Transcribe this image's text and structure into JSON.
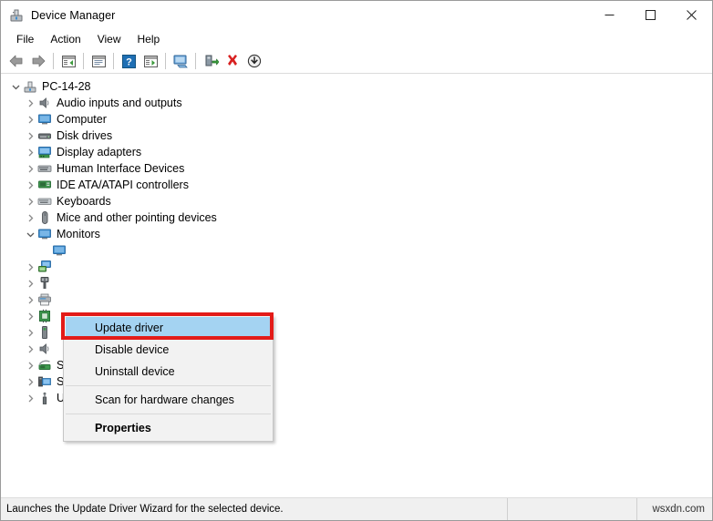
{
  "window": {
    "title": "Device Manager",
    "icon": "device-manager-icon",
    "controls": {
      "minimize": "–",
      "maximize": "□",
      "close": "✕"
    }
  },
  "menubar": {
    "items": [
      {
        "label": "File"
      },
      {
        "label": "Action"
      },
      {
        "label": "View"
      },
      {
        "label": "Help"
      }
    ]
  },
  "toolbar": {
    "buttons": [
      {
        "name": "back-icon",
        "title": "Back"
      },
      {
        "name": "forward-icon",
        "title": "Forward"
      },
      {
        "name": "show-hide-console-tree-icon",
        "title": "Show/Hide Console Tree"
      },
      {
        "name": "properties-icon",
        "title": "Properties"
      },
      {
        "name": "help-icon",
        "title": "Help"
      },
      {
        "name": "show-hide-action-pane-icon",
        "title": "Show/Hide Action Pane"
      },
      {
        "name": "scan-for-hardware-changes-icon",
        "title": "Scan for hardware changes"
      },
      {
        "name": "update-driver-icon",
        "title": "Update driver"
      },
      {
        "name": "uninstall-device-icon",
        "title": "Uninstall device"
      },
      {
        "name": "disable-device-icon",
        "title": "Disable device"
      }
    ]
  },
  "tree": {
    "root": {
      "label": "PC-14-28",
      "icon": "computer-root-icon",
      "expanded": true
    },
    "items": [
      {
        "label": "Audio inputs and outputs",
        "icon": "speaker-icon",
        "expanded": false
      },
      {
        "label": "Computer",
        "icon": "monitor-icon",
        "expanded": false
      },
      {
        "label": "Disk drives",
        "icon": "disk-drive-icon",
        "expanded": false
      },
      {
        "label": "Display adapters",
        "icon": "display-adapter-icon",
        "expanded": false
      },
      {
        "label": "Human Interface Devices",
        "icon": "hid-icon",
        "expanded": false
      },
      {
        "label": "IDE ATA/ATAPI controllers",
        "icon": "ide-controller-icon",
        "expanded": false
      },
      {
        "label": "Keyboards",
        "icon": "keyboard-icon",
        "expanded": false
      },
      {
        "label": "Mice and other pointing devices",
        "icon": "mouse-icon",
        "expanded": false
      },
      {
        "label": "Monitors",
        "icon": "monitor-icon",
        "expanded": true
      }
    ],
    "monitor_children": [
      {
        "label": "",
        "icon": "monitor-child-icon"
      }
    ],
    "obscured_items": [
      {
        "label": "",
        "icon": "network-adapter-icon"
      },
      {
        "label": "",
        "icon": "port-icon"
      },
      {
        "label": "",
        "icon": "print-queue-icon"
      },
      {
        "label": "",
        "icon": "processor-icon"
      },
      {
        "label": "",
        "icon": "software-device-icon"
      },
      {
        "label": "",
        "icon": "sound-video-icon"
      }
    ],
    "items_bottom": [
      {
        "label": "Storage controllers",
        "icon": "storage-controller-icon",
        "expanded": false
      },
      {
        "label": "System devices",
        "icon": "system-device-icon",
        "expanded": false
      },
      {
        "label": "Universal Serial Bus controllers",
        "icon": "usb-controller-icon",
        "expanded": false
      }
    ]
  },
  "context_menu": {
    "items": [
      {
        "label": "Update driver",
        "highlighted": true,
        "bold": false
      },
      {
        "label": "Disable device",
        "highlighted": false,
        "bold": false
      },
      {
        "label": "Uninstall device",
        "highlighted": false,
        "bold": false
      },
      {
        "separator": true
      },
      {
        "label": "Scan for hardware changes",
        "highlighted": false,
        "bold": false
      },
      {
        "separator": true
      },
      {
        "label": "Properties",
        "highlighted": false,
        "bold": true
      }
    ]
  },
  "highlight": {
    "color": "#e31b18",
    "target": "Update driver"
  },
  "statusbar": {
    "message": "Launches the Update Driver Wizard for the selected device.",
    "middle": "",
    "watermark": "wsxdn.com"
  },
  "colors": {
    "selection_blue": "#a4d3f2",
    "highlight_red": "#e31b18",
    "menu_bg": "#f2f2f2",
    "status_bg": "#f0f0f0"
  }
}
